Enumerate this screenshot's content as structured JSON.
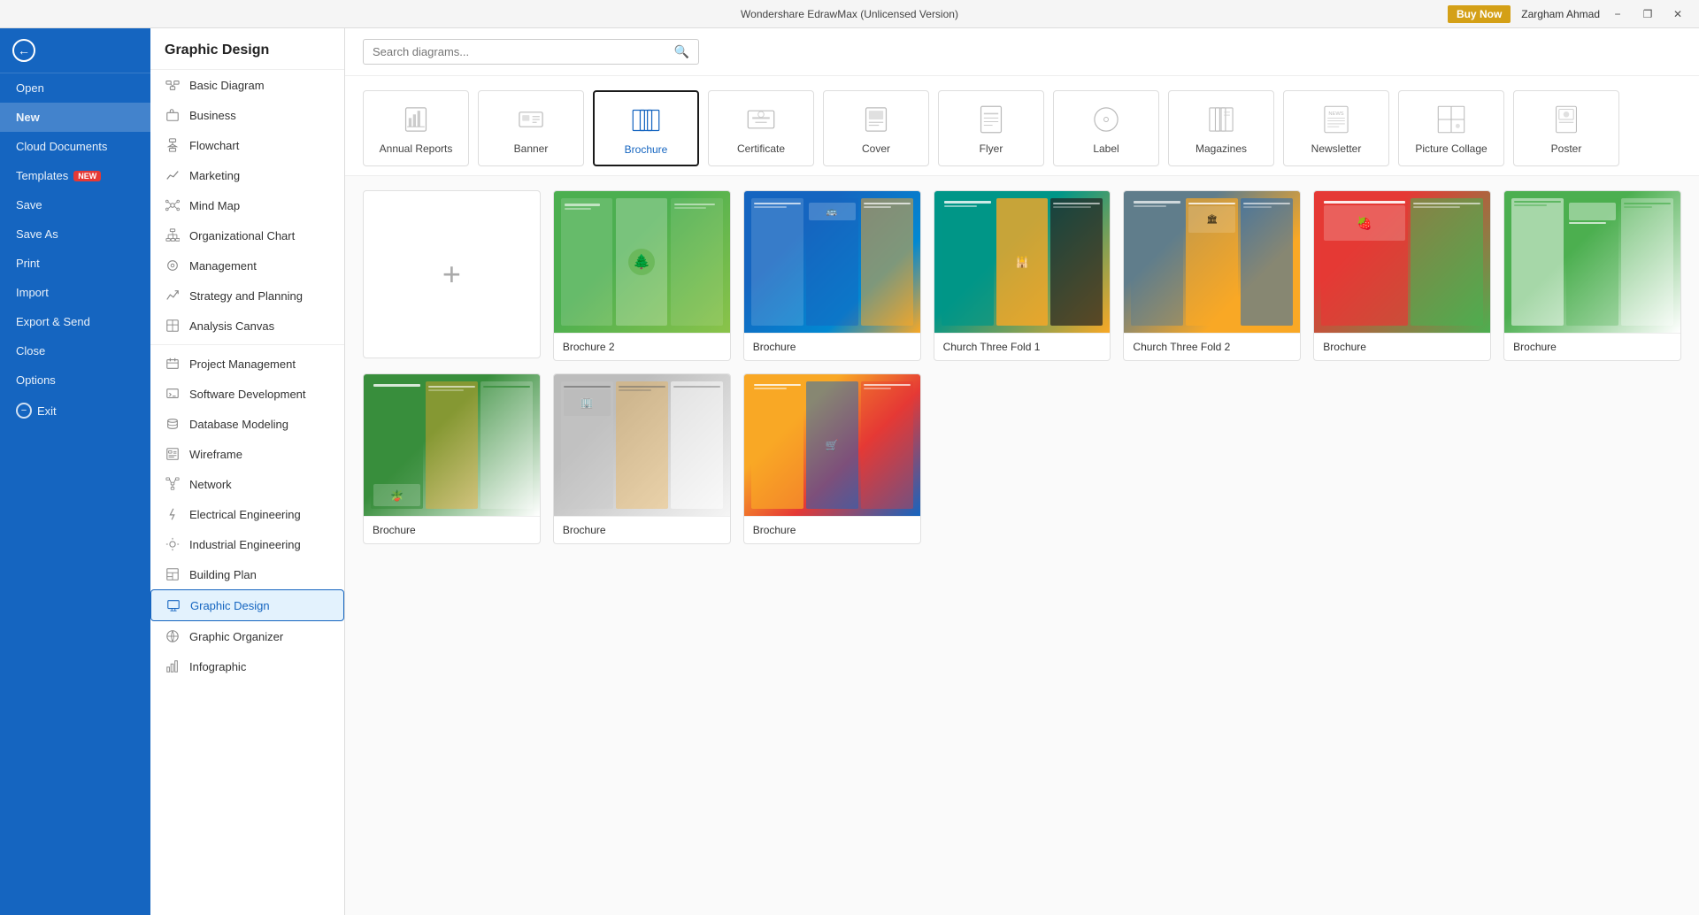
{
  "titleBar": {
    "appTitle": "Wondershare EdrawMax (Unlicensed Version)",
    "minimize": "−",
    "restore": "❐",
    "close": "✕",
    "buyNow": "Buy Now",
    "userName": "Zargham Ahmad"
  },
  "leftNav": {
    "back": "←",
    "items": [
      {
        "id": "open",
        "label": "Open"
      },
      {
        "id": "new",
        "label": "New",
        "active": true
      },
      {
        "id": "cloud",
        "label": "Cloud Documents"
      },
      {
        "id": "templates",
        "label": "Templates",
        "badge": "NEW"
      },
      {
        "id": "save",
        "label": "Save"
      },
      {
        "id": "save-as",
        "label": "Save As"
      },
      {
        "id": "print",
        "label": "Print"
      },
      {
        "id": "import",
        "label": "Import"
      },
      {
        "id": "export",
        "label": "Export & Send"
      },
      {
        "id": "close",
        "label": "Close"
      },
      {
        "id": "options",
        "label": "Options"
      },
      {
        "id": "exit",
        "label": "Exit"
      }
    ]
  },
  "secondNav": {
    "header": "Graphic Design",
    "items": [
      {
        "id": "basic",
        "label": "Basic Diagram"
      },
      {
        "id": "business",
        "label": "Business"
      },
      {
        "id": "flowchart",
        "label": "Flowchart"
      },
      {
        "id": "marketing",
        "label": "Marketing"
      },
      {
        "id": "mindmap",
        "label": "Mind Map"
      },
      {
        "id": "orgchart",
        "label": "Organizational Chart"
      },
      {
        "id": "management",
        "label": "Management"
      },
      {
        "id": "strategy",
        "label": "Strategy and Planning"
      },
      {
        "id": "analysis",
        "label": "Analysis Canvas"
      },
      {
        "id": "project",
        "label": "Project Management"
      },
      {
        "id": "software",
        "label": "Software Development"
      },
      {
        "id": "database",
        "label": "Database Modeling"
      },
      {
        "id": "wireframe",
        "label": "Wireframe"
      },
      {
        "id": "network",
        "label": "Network"
      },
      {
        "id": "electrical",
        "label": "Electrical Engineering"
      },
      {
        "id": "industrial",
        "label": "Industrial Engineering"
      },
      {
        "id": "building",
        "label": "Building Plan"
      },
      {
        "id": "graphic",
        "label": "Graphic Design",
        "active": true
      },
      {
        "id": "organizer",
        "label": "Graphic Organizer"
      },
      {
        "id": "infographic",
        "label": "Infographic"
      }
    ]
  },
  "search": {
    "placeholder": "Search diagrams..."
  },
  "categories": [
    {
      "id": "annual",
      "label": "Annual Reports",
      "selected": false
    },
    {
      "id": "banner",
      "label": "Banner",
      "selected": false
    },
    {
      "id": "brochure",
      "label": "Brochure",
      "selected": true
    },
    {
      "id": "certificate",
      "label": "Certificate",
      "selected": false
    },
    {
      "id": "cover",
      "label": "Cover",
      "selected": false
    },
    {
      "id": "flyer",
      "label": "Flyer",
      "selected": false
    },
    {
      "id": "label",
      "label": "Label",
      "selected": false
    },
    {
      "id": "magazines",
      "label": "Magazines",
      "selected": false
    },
    {
      "id": "newsletter",
      "label": "Newsletter",
      "selected": false
    },
    {
      "id": "picturecollage",
      "label": "Picture Collage",
      "selected": false
    },
    {
      "id": "poster",
      "label": "Poster",
      "selected": false
    }
  ],
  "templates": [
    {
      "id": "blank",
      "label": "",
      "type": "blank"
    },
    {
      "id": "brochure2",
      "label": "Brochure 2",
      "type": "brochure2"
    },
    {
      "id": "brochure",
      "label": "Brochure",
      "type": "brochure"
    },
    {
      "id": "church1",
      "label": "Church Three Fold 1",
      "type": "church1"
    },
    {
      "id": "church2",
      "label": "Church Three Fold 2",
      "type": "church2"
    },
    {
      "id": "food1",
      "label": "Brochure",
      "type": "food1"
    },
    {
      "id": "corp",
      "label": "Brochure",
      "type": "corp"
    },
    {
      "id": "furniture",
      "label": "Brochure",
      "type": "furniture"
    },
    {
      "id": "arch",
      "label": "Brochure",
      "type": "arch"
    },
    {
      "id": "super",
      "label": "Brochure",
      "type": "super"
    }
  ]
}
